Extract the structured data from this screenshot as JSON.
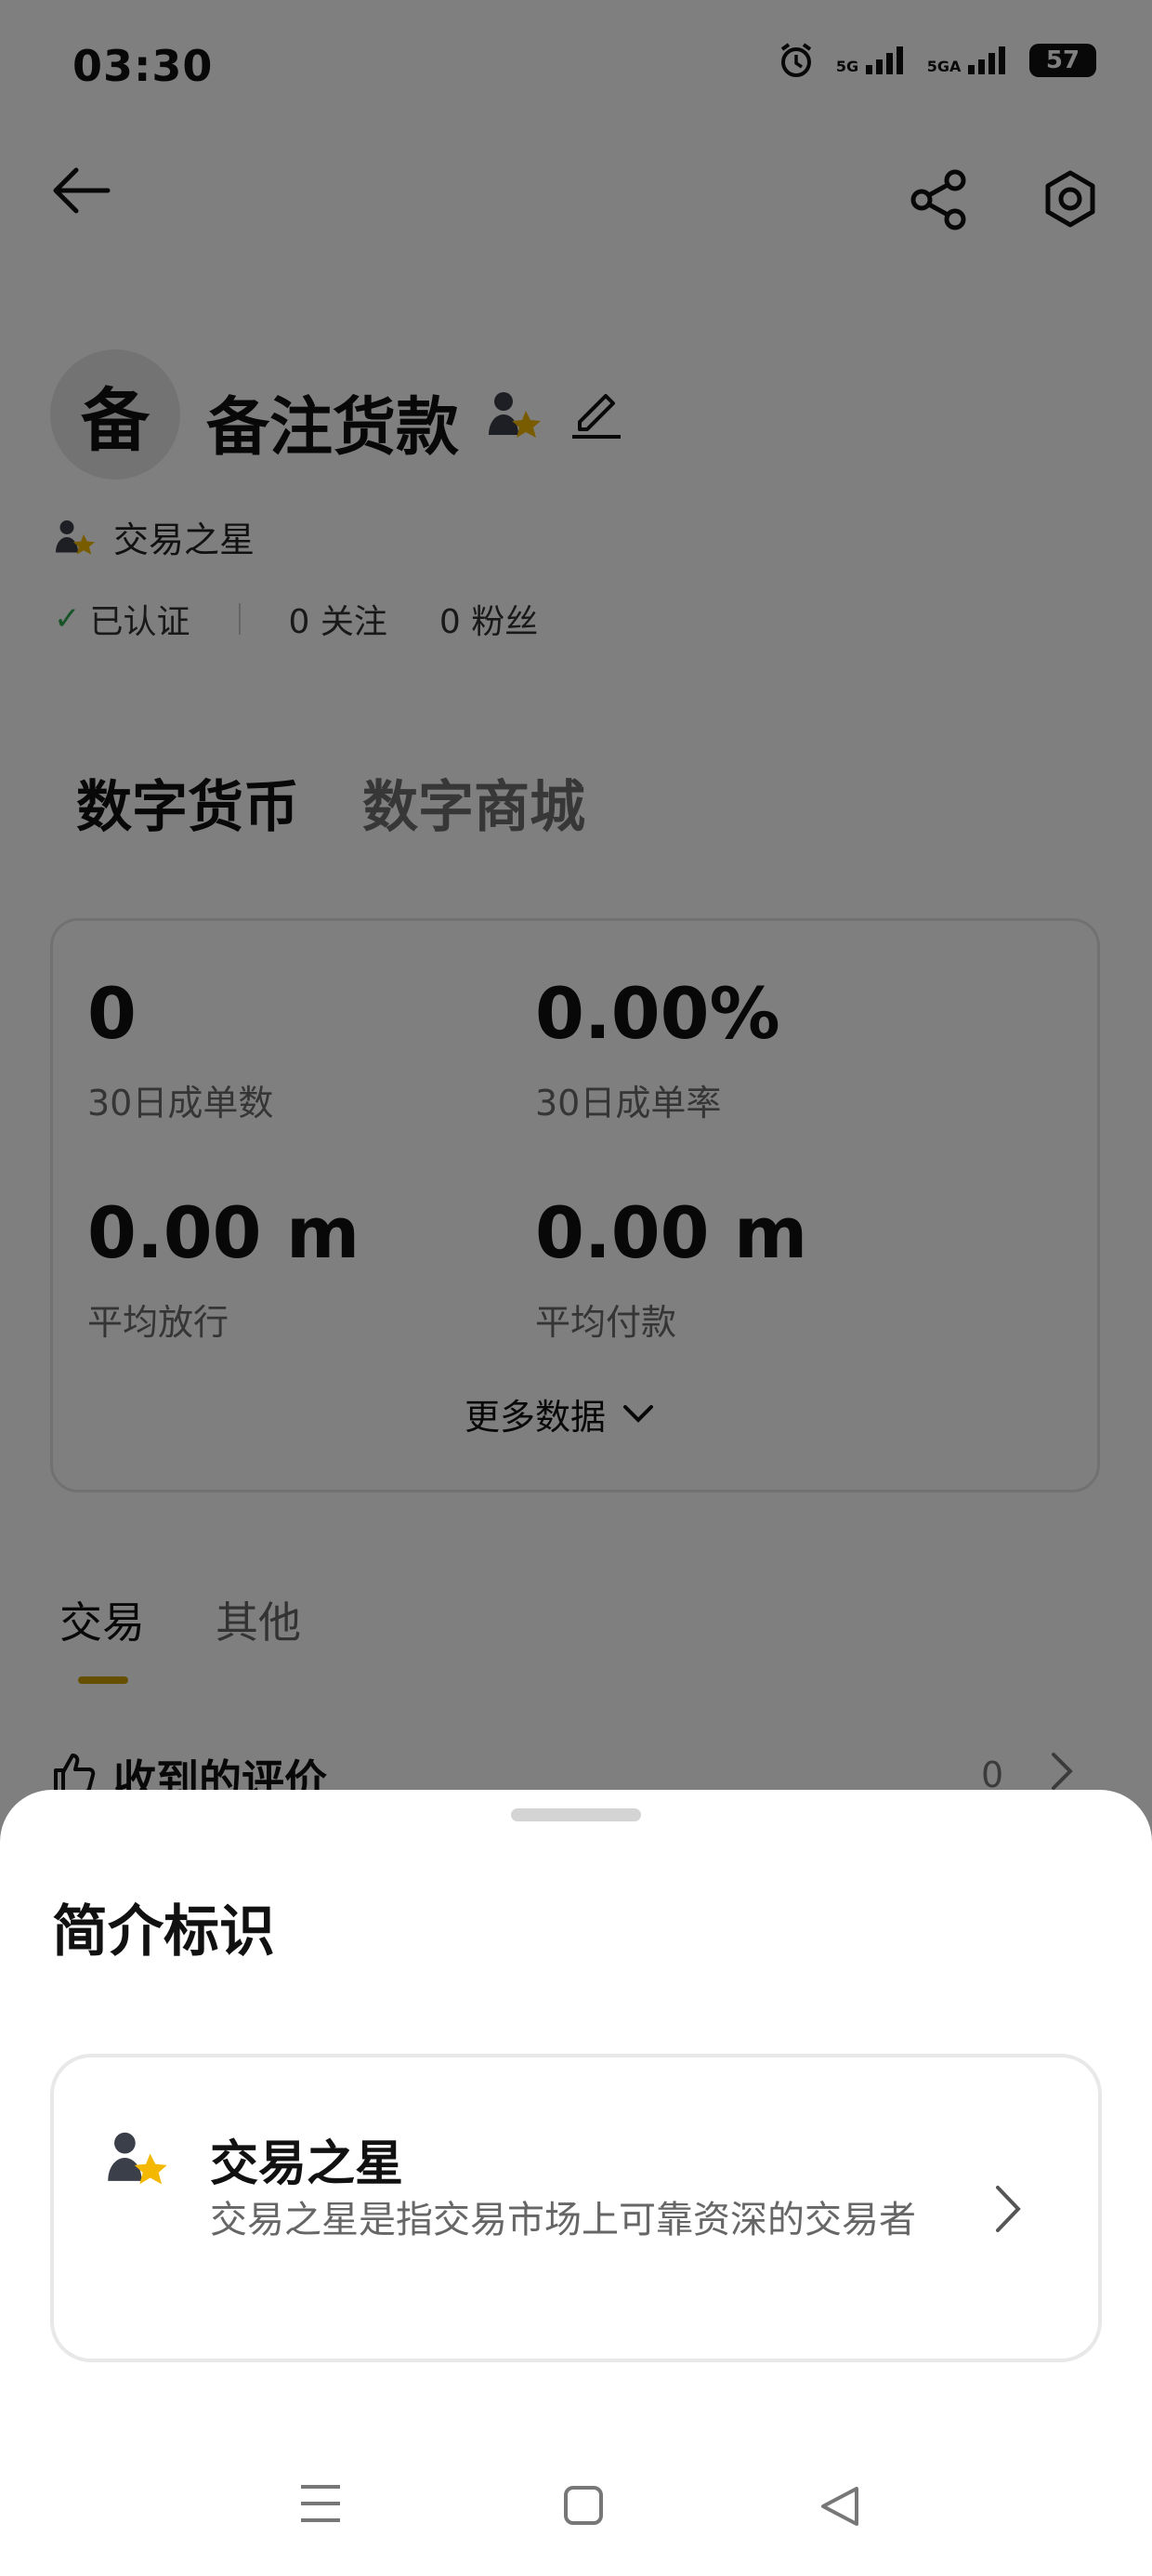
{
  "status_bar": {
    "time": "03:30",
    "signal1": "5G",
    "signal2": "5GA",
    "battery": "57"
  },
  "profile": {
    "avatar_char": "备",
    "name": "备注货款",
    "badge_label": "交易之星",
    "verified_label": "已认证",
    "following": "0 关注",
    "followers": "0 粉丝"
  },
  "tabs": [
    "数字货币",
    "数字商城"
  ],
  "stats": [
    {
      "value": "0",
      "label": "30日成单数"
    },
    {
      "value": "0.00%",
      "label": "30日成单率"
    },
    {
      "value": "0.00 m",
      "label": "平均放行"
    },
    {
      "value": "0.00 m",
      "label": "平均付款"
    }
  ],
  "more_data_label": "更多数据",
  "sub_tabs": [
    "交易",
    "其他"
  ],
  "reviews": {
    "label": "收到的评价",
    "count": "0"
  },
  "sheet": {
    "title": "简介标识",
    "item_name": "交易之星",
    "item_desc": "交易之星是指交易市场上可靠资深的交易者"
  },
  "colors": {
    "accent": "#c9a000",
    "star": "#f5b800",
    "verified": "#2fa84f",
    "overlay": "rgba(0,0,0,0.5)"
  },
  "icons": [
    "back-arrow-icon",
    "share-icon",
    "settings-icon",
    "trader-star-icon",
    "edit-icon",
    "check-icon",
    "chevron-down-icon",
    "thumbs-up-icon",
    "chevron-right-icon",
    "menu-icon",
    "home-icon",
    "back-triangle-icon"
  ]
}
